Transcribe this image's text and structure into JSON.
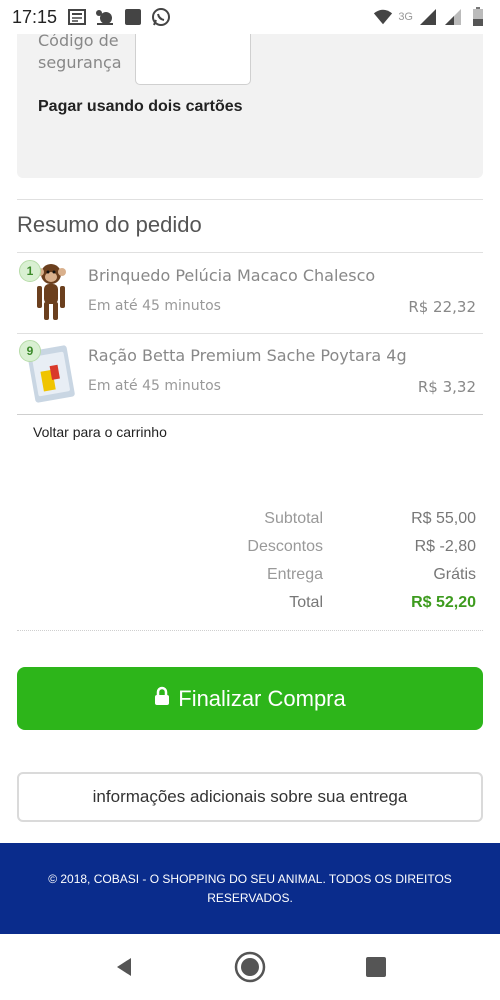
{
  "status_bar": {
    "time": "17:15",
    "network": "3G",
    "icons_left": [
      "news-icon",
      "alarm-icon",
      "app-square-icon",
      "whatsapp-icon"
    ],
    "icons_right": [
      "wifi-icon",
      "signal-icon",
      "signal-icon",
      "battery-icon"
    ]
  },
  "payment": {
    "security_code_label": "Código de segurança",
    "security_code_value": "",
    "two_cards_label": "Pagar usando dois cartões"
  },
  "summary": {
    "title": "Resumo do pedido",
    "items": [
      {
        "qty": "1",
        "name": "Brinquedo Pelúcia Macaco Chalesco",
        "eta": "Em até 45 minutos",
        "price": "R$ 22,32"
      },
      {
        "qty": "9",
        "name": "Ração Betta Premium Sache Poytara 4g",
        "eta": "Em até 45 minutos",
        "price": "R$ 3,32"
      }
    ],
    "back_link": "Voltar para o carrinho"
  },
  "totals": {
    "subtotal_label": "Subtotal",
    "subtotal_value": "R$ 55,00",
    "discount_label": "Descontos",
    "discount_value": "R$ -2,80",
    "delivery_label": "Entrega",
    "delivery_value": "Grátis",
    "total_label": "Total",
    "total_value": "R$ 52,20"
  },
  "actions": {
    "finish_label": "Finalizar Compra",
    "info_label": "informações adicionais sobre sua entrega"
  },
  "footer": {
    "text": "© 2018, COBASI - O SHOPPING DO SEU ANIMAL. TODOS OS DIREITOS RESERVADOS."
  },
  "colors": {
    "accent_green": "#2db51a",
    "total_green": "#3d9b1e",
    "footer_blue": "#0a2c8c"
  }
}
